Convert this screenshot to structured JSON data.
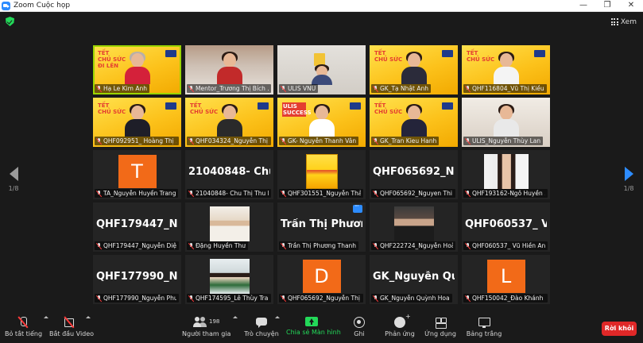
{
  "window": {
    "title": "Zoom Cuộc họp",
    "minimize": "—",
    "maximize": "❐",
    "close": "✕"
  },
  "header": {
    "view_label": "Xem"
  },
  "pager": {
    "left_label": "1/8",
    "right_label": "1/8"
  },
  "tiles": [
    {
      "name": "Hạ Le Kim Anh",
      "bg": "yellow"
    },
    {
      "name": "Mentor_Trương Thị Bích ..."
    },
    {
      "name": "ULIS VNU"
    },
    {
      "name": "GK_Tạ Nhật Anh"
    },
    {
      "name": "QHF116804_Vũ Thị Kiều"
    },
    {
      "name": "QHF092951_ Hoàng Thị ..."
    },
    {
      "name": "QHF034324_Nguyễn Thị ..."
    },
    {
      "name": "GK- Nguyễn Thanh Vân"
    },
    {
      "name": "GK_Tran Kieu Hanh"
    },
    {
      "name": "ULIS_Nguyễn Thùy Lan"
    },
    {
      "name": "TA_Nguyễn Huyền Trang",
      "avatar": "T"
    },
    {
      "name": "21040848- Chu Thị Thu H...",
      "big": "21040848- Chu..."
    },
    {
      "name": "QHF301551_Nguyễn Thả..."
    },
    {
      "name": "QHF065692_Nguyen Thi ...",
      "big": "QHF065692_Ng..."
    },
    {
      "name": "QHF193162-Ngô Huyền ..."
    },
    {
      "name": "QHF179447_Nguyễn Diệu...",
      "big": "QHF179447_Ng..."
    },
    {
      "name": "Đặng Huyền Thư"
    },
    {
      "name": "Trần Thị Phương Thanh",
      "big": "Trần Thị Phươn..."
    },
    {
      "name": "QHF222724_Nguyễn Hoà..."
    },
    {
      "name": "QHF060537_ Vũ Hiền Anh",
      "big": "QHF060537_ Vũ..."
    },
    {
      "name": "QHF177990_Nguyễn Phư...",
      "big": "QHF177990_Ng..."
    },
    {
      "name": "QHF174595_Lê Thùy Tran..."
    },
    {
      "name": "QHF065692_Nguyễn Thị ...",
      "avatar": "D"
    },
    {
      "name": "GK_Nguyễn Quỳnh Hoa",
      "big": "GK_Nguyễn Qu..."
    },
    {
      "name": "QHF150042_Đào Khánh L...",
      "avatar": "L"
    }
  ],
  "toolbar": {
    "mute": "Bỏ tắt tiếng",
    "video": "Bắt đầu Video",
    "participants": "Người tham gia",
    "participants_count": "198",
    "chat": "Trò chuyện",
    "share": "Chia sẻ Màn hình",
    "record": "Ghi",
    "reactions": "Phản ứng",
    "apps": "Ứng dụng",
    "whiteboard": "Bảng trắng",
    "leave": "Rời khỏi"
  },
  "colors": {
    "accent": "#2d8cff",
    "active_speaker": "#9bd400",
    "share_green": "#23d959",
    "leave_red": "#e02828",
    "avatar_orange": "#f26a18"
  }
}
